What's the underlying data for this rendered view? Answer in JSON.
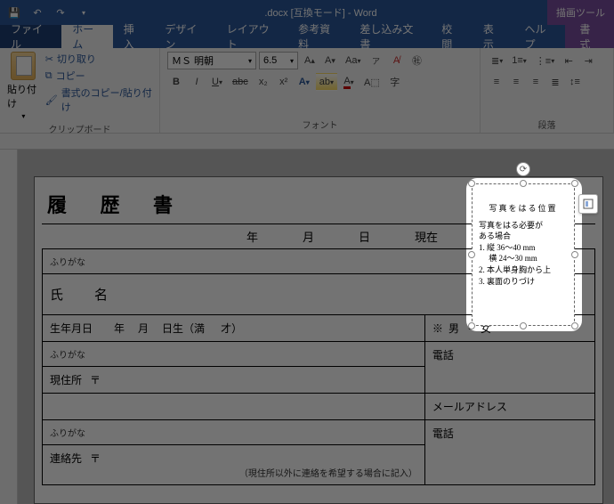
{
  "titlebar": {
    "filename": ".docx [互換モード] - Word",
    "drawing_tools": "描画ツール"
  },
  "tabs": {
    "file": "ファイル",
    "home": "ホーム",
    "insert": "挿入",
    "design": "デザイン",
    "layout": "レイアウト",
    "references": "参考資料",
    "mailings": "差し込み文書",
    "review": "校閲",
    "view": "表示",
    "help": "ヘルプ",
    "format": "書式"
  },
  "ribbon": {
    "clipboard": {
      "paste": "貼り付け",
      "cut": "切り取り",
      "copy": "コピー",
      "format_painter": "書式のコピー/貼り付け",
      "group": "クリップボード"
    },
    "font": {
      "name": "ＭＳ 明朝",
      "size": "6.5",
      "group": "フォント"
    },
    "paragraph": {
      "group": "段落"
    }
  },
  "doc": {
    "title": "履 歴 書",
    "year": "年",
    "month": "月",
    "day": "日",
    "current": "現在",
    "furigana": "ふりがな",
    "name_label": "氏　名",
    "birth_label": "生年月日",
    "birth_suffix_day": "日生（満",
    "birth_suffix_age": "才）",
    "sex_sep": "※",
    "sex_m": "男",
    "sex_dot": "・",
    "sex_f": "女",
    "address_label": "現住所",
    "postal": "〒",
    "tel": "電話",
    "email": "メールアドレス",
    "contact_label": "連絡先",
    "contact_note": "（現住所以外に連絡を希望する場合に記入）"
  },
  "textbox": {
    "heading": "写真をはる位置",
    "line1": "写真をはる必要が",
    "line2": "ある場合",
    "li1": "1. 縦 36～40 mm",
    "li1b": "　 横 24～30 mm",
    "li2": "2. 本人単身胸から上",
    "li3": "3. 裏面のりづけ"
  }
}
